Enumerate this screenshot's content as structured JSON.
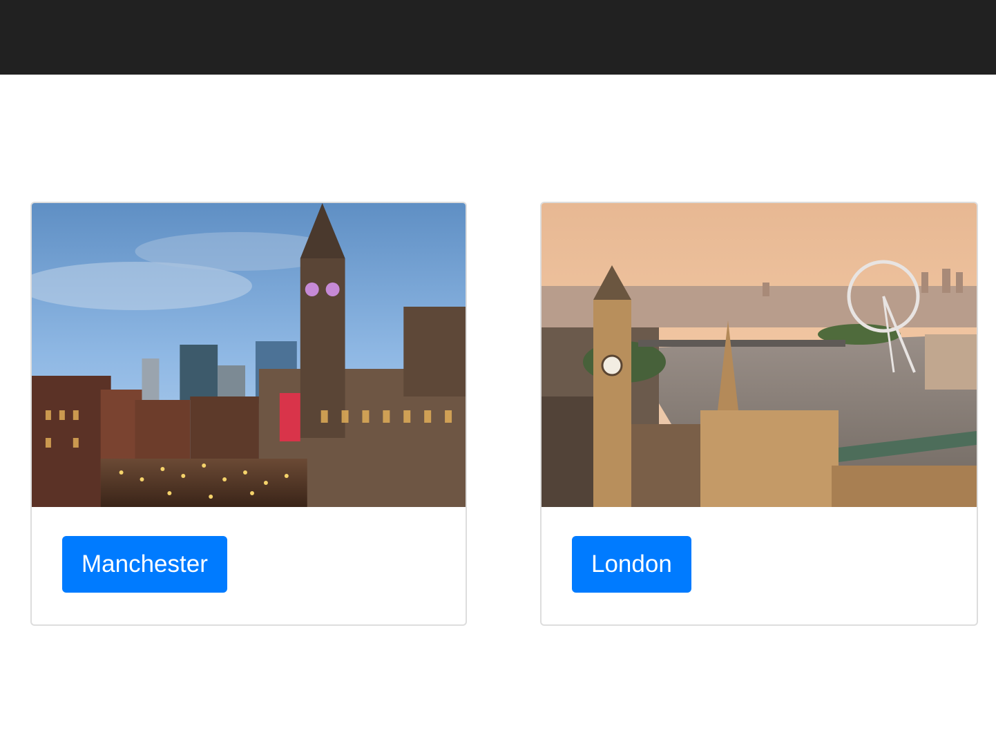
{
  "navbar": {
    "background": "#212121"
  },
  "cards": [
    {
      "button_label": "Manchester",
      "image": "manchester-town-hall-christmas-market-photo"
    },
    {
      "button_label": "London",
      "image": "london-big-ben-thames-london-eye-photo"
    }
  ],
  "colors": {
    "button_bg": "#007bff",
    "button_text": "#ffffff",
    "card_border": "#dddddd"
  }
}
